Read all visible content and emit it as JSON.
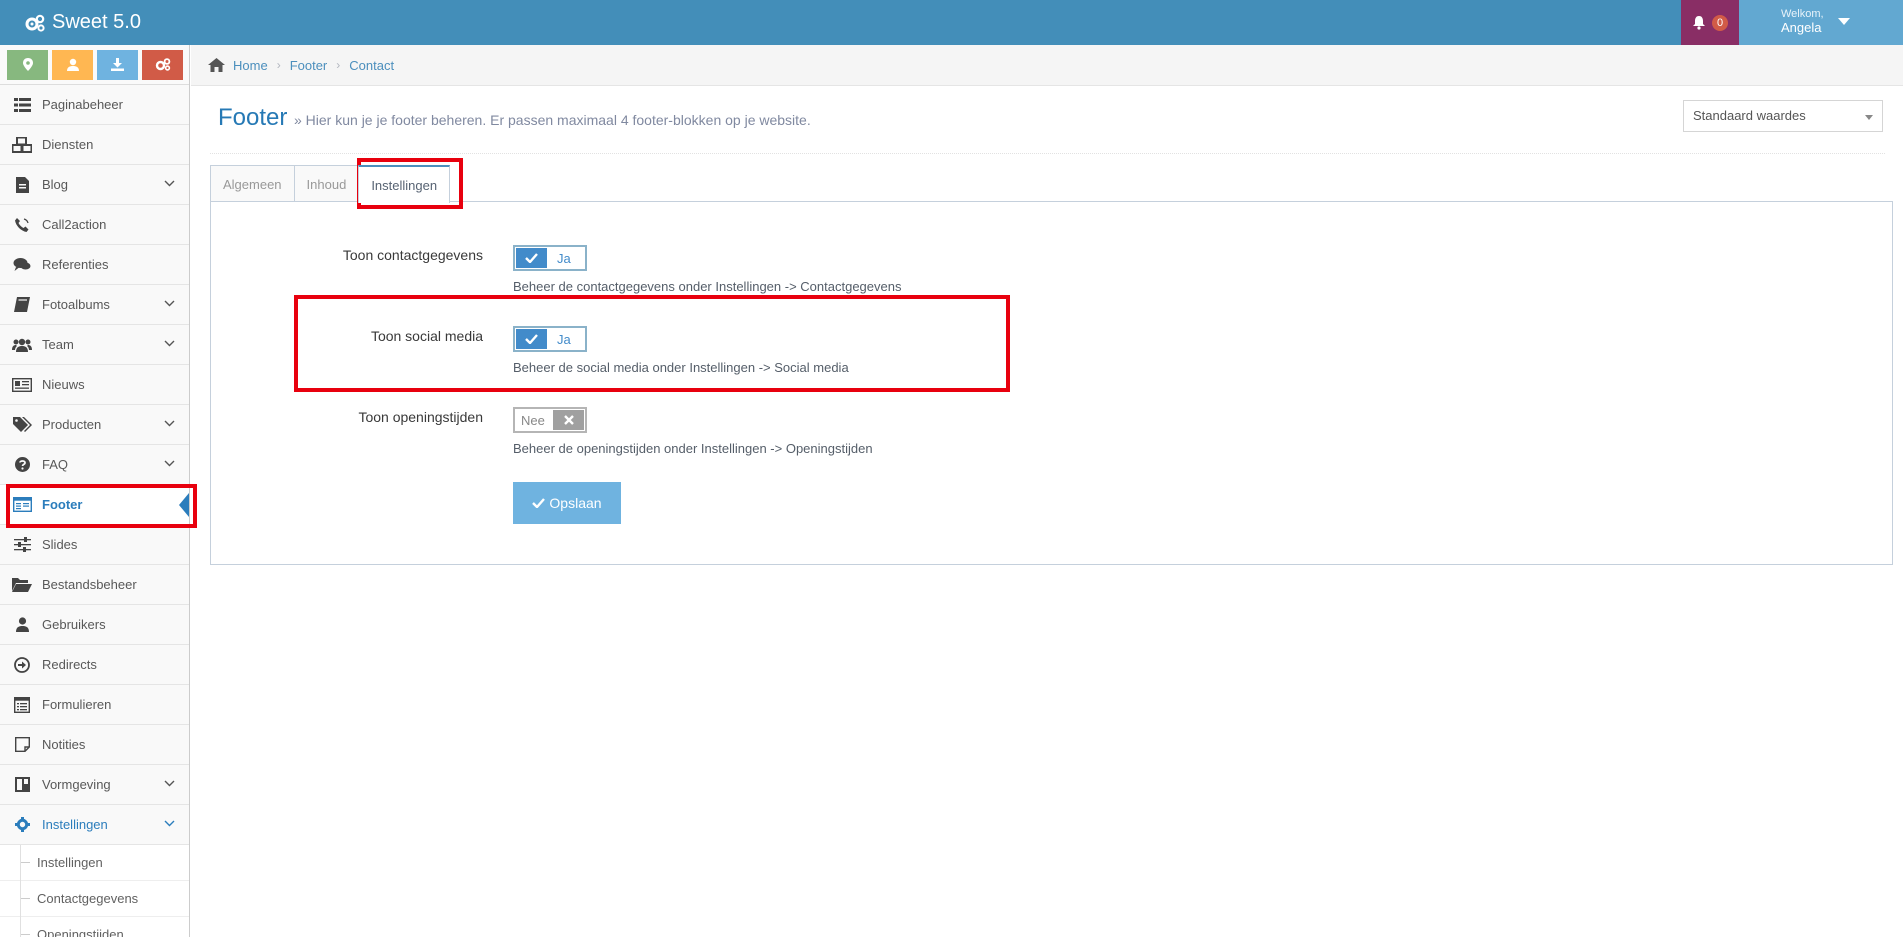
{
  "app": {
    "brand": "Sweet 5.0",
    "notifications_count": "0",
    "welcome": "Welkom,",
    "username": "Angela"
  },
  "colors": {
    "navbar": "#438eb9",
    "accent": "#2b7dbc",
    "highlight": "#e8000e",
    "shortcut_green": "#87b87f",
    "shortcut_orange": "#ffb752",
    "shortcut_blue": "#6fb3e0",
    "shortcut_red": "#d15b47"
  },
  "sidebar": {
    "shortcuts": [
      {
        "icon": "map-marker-icon"
      },
      {
        "icon": "user-icon"
      },
      {
        "icon": "download-icon"
      },
      {
        "icon": "cogs-icon"
      }
    ],
    "items": [
      {
        "label": "Paginabeheer",
        "icon": "list-icon",
        "has_submenu": false
      },
      {
        "label": "Diensten",
        "icon": "cubes-icon",
        "has_submenu": false
      },
      {
        "label": "Blog",
        "icon": "file-icon",
        "has_submenu": true
      },
      {
        "label": "Call2action",
        "icon": "phone-icon",
        "has_submenu": false
      },
      {
        "label": "Referenties",
        "icon": "comments-icon",
        "has_submenu": false
      },
      {
        "label": "Fotoalbums",
        "icon": "book-icon",
        "has_submenu": true
      },
      {
        "label": "Team",
        "icon": "users-icon",
        "has_submenu": true
      },
      {
        "label": "Nieuws",
        "icon": "newspaper-icon",
        "has_submenu": false
      },
      {
        "label": "Producten",
        "icon": "tags-icon",
        "has_submenu": true
      },
      {
        "label": "FAQ",
        "icon": "question-icon",
        "has_submenu": true
      },
      {
        "label": "Footer",
        "icon": "footer-icon",
        "has_submenu": false
      },
      {
        "label": "Slides",
        "icon": "sliders-icon",
        "has_submenu": false
      },
      {
        "label": "Bestandsbeheer",
        "icon": "folder-open-icon",
        "has_submenu": false
      },
      {
        "label": "Gebruikers",
        "icon": "user-icon",
        "has_submenu": false
      },
      {
        "label": "Redirects",
        "icon": "arrow-circle-icon",
        "has_submenu": false
      },
      {
        "label": "Formulieren",
        "icon": "form-icon",
        "has_submenu": false
      },
      {
        "label": "Notities",
        "icon": "sticky-note-icon",
        "has_submenu": false
      },
      {
        "label": "Vormgeving",
        "icon": "layout-icon",
        "has_submenu": true
      },
      {
        "label": "Instellingen",
        "icon": "gear-icon",
        "has_submenu": true
      }
    ],
    "sub_items": [
      {
        "label": "Instellingen"
      },
      {
        "label": "Contactgegevens"
      },
      {
        "label": "Openingstijden"
      }
    ]
  },
  "breadcrumb": {
    "home": "Home",
    "section": "Footer",
    "current": "Contact"
  },
  "page": {
    "title": "Footer",
    "subtitle": "» Hier kun je je footer beheren. Er passen maximaal 4 footer-blokken op je website.",
    "select_value": "Standaard waardes"
  },
  "tabs": [
    {
      "label": "Algemeen"
    },
    {
      "label": "Inhoud"
    },
    {
      "label": "Instellingen"
    }
  ],
  "settings": {
    "contact": {
      "label": "Toon contactgegevens",
      "value": "Ja",
      "help": "Beheer de contactgegevens onder Instellingen -> Contactgegevens"
    },
    "social": {
      "label": "Toon social media",
      "value": "Ja",
      "help": "Beheer de social media onder Instellingen -> Social media"
    },
    "hours": {
      "label": "Toon openingstijden",
      "value": "Nee",
      "help": "Beheer de openingstijden onder Instellingen -> Openingstijden"
    },
    "save_label": "Opslaan"
  }
}
